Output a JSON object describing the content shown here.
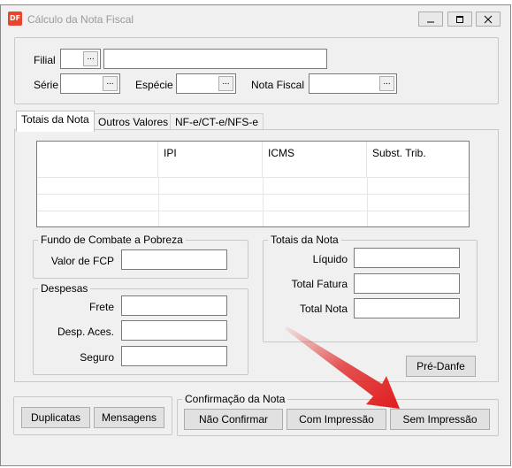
{
  "window": {
    "title": "Cálculo da Nota Fiscal",
    "icon_text": "DF",
    "controls": [
      "minimize-icon",
      "maximize-icon",
      "close-icon"
    ]
  },
  "filters": {
    "filial_label": "Filial",
    "filial_code": "",
    "filial_name": "",
    "serie_label": "Série",
    "serie_value": "",
    "especie_label": "Espécie",
    "especie_value": "",
    "nota_fiscal_label": "Nota Fiscal",
    "nota_fiscal_value": "",
    "lookup_label": "..."
  },
  "tabs": [
    {
      "label": "Totais da Nota",
      "active": true
    },
    {
      "label": "Outros Valores",
      "active": false
    },
    {
      "label": "NF-e/CT-e/NFS-e",
      "active": false
    }
  ],
  "grid": {
    "columns": [
      "",
      "IPI",
      "ICMS",
      "Subst. Trib."
    ],
    "rows": [
      [
        "",
        "",
        "",
        ""
      ],
      [
        "",
        "",
        "",
        ""
      ],
      [
        "",
        "",
        "",
        ""
      ]
    ]
  },
  "fcp_group": {
    "title": "Fundo de Combate a Pobreza",
    "valor_fcp_label": "Valor de FCP",
    "valor_fcp_value": ""
  },
  "despesas_group": {
    "title": "Despesas",
    "frete_label": "Frete",
    "frete_value": "",
    "desp_aces_label": "Desp. Aces.",
    "desp_aces_value": "",
    "seguro_label": "Seguro",
    "seguro_value": ""
  },
  "totais_group": {
    "title": "Totais da Nota",
    "liquido_label": "Líquido",
    "liquido_value": "",
    "total_fatura_label": "Total Fatura",
    "total_fatura_value": "",
    "total_nota_label": "Total Nota",
    "total_nota_value": ""
  },
  "pre_danfe_label": "Pré-Danfe",
  "bottom": {
    "duplicatas_label": "Duplicatas",
    "mensagens_label": "Mensagens",
    "confirm_group_title": "Confirmação da Nota",
    "nao_confirmar_label": "Não Confirmar",
    "com_impressao_label": "Com Impressão",
    "sem_impressao_label": "Sem Impressão"
  },
  "colors": {
    "window_bg": "#f0f0f0",
    "annotation_arrow": "#e01c1c",
    "icon_bg": "#e8452c"
  }
}
